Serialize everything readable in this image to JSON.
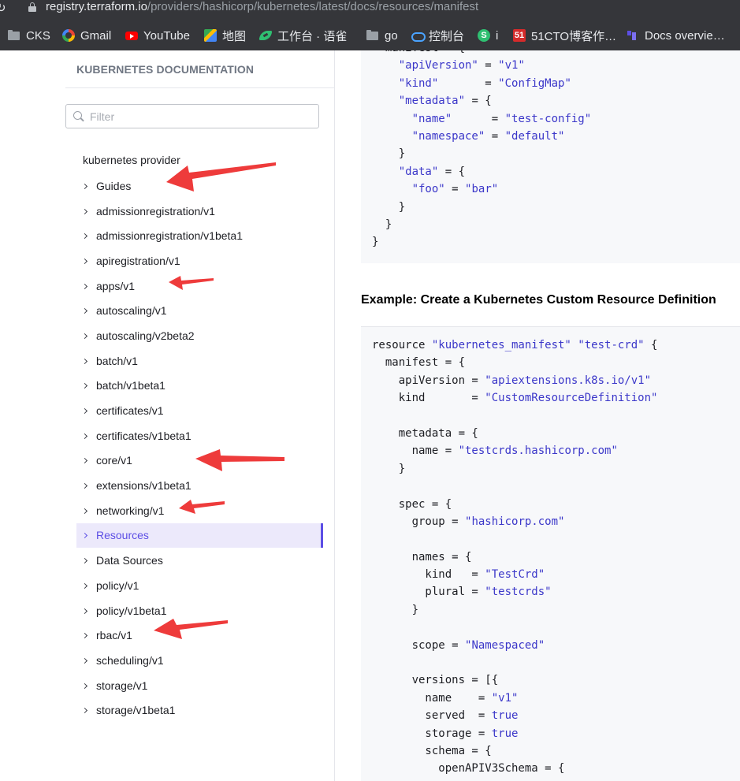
{
  "browser": {
    "reload_glyph": "↻",
    "url_host": "registry.terraform.io",
    "url_path": "/providers/hashicorp/kubernetes/latest/docs/resources/manifest",
    "bookmarks": [
      {
        "label": "CKS",
        "icon": "folder-icon"
      },
      {
        "label": "Gmail",
        "icon": "google-icon"
      },
      {
        "label": "YouTube",
        "icon": "youtube-icon"
      },
      {
        "label": "地图",
        "icon": "maps-icon"
      },
      {
        "label": "工作台 · 语雀",
        "icon": "yuque-icon"
      },
      {
        "label": "go",
        "icon": "folder-icon"
      },
      {
        "label": "控制台",
        "icon": "cloud-console-icon"
      },
      {
        "label": "i",
        "icon": "s-logo-icon"
      },
      {
        "label": "51CTO博客作…",
        "icon": "51cto-icon"
      },
      {
        "label": "Docs overvie…",
        "icon": "terraform-icon"
      }
    ]
  },
  "sidebar": {
    "heading": "KUBERNETES DOCUMENTATION",
    "filter_placeholder": "Filter",
    "provider_label": "kubernetes provider",
    "items": [
      {
        "label": "Guides"
      },
      {
        "label": "admissionregistration/v1"
      },
      {
        "label": "admissionregistration/v1beta1"
      },
      {
        "label": "apiregistration/v1"
      },
      {
        "label": "apps/v1"
      },
      {
        "label": "autoscaling/v1"
      },
      {
        "label": "autoscaling/v2beta2"
      },
      {
        "label": "batch/v1"
      },
      {
        "label": "batch/v1beta1"
      },
      {
        "label": "certificates/v1"
      },
      {
        "label": "certificates/v1beta1"
      },
      {
        "label": "core/v1"
      },
      {
        "label": "extensions/v1beta1"
      },
      {
        "label": "networking/v1"
      },
      {
        "label": "Resources"
      },
      {
        "label": "Data Sources"
      },
      {
        "label": "policy/v1"
      },
      {
        "label": "policy/v1beta1"
      },
      {
        "label": "rbac/v1"
      },
      {
        "label": "scheduling/v1"
      },
      {
        "label": "storage/v1"
      },
      {
        "label": "storage/v1beta1"
      }
    ],
    "active_item": "Resources"
  },
  "content": {
    "first_code_lines": [
      "  manifest = {",
      "    \"apiVersion\" = \"v1\"",
      "    \"kind\"       = \"ConfigMap\"",
      "    \"metadata\" = {",
      "      \"name\"      = \"test-config\"",
      "      \"namespace\" = \"default\"",
      "    }",
      "    \"data\" = {",
      "      \"foo\" = \"bar\"",
      "    }",
      "  }",
      "}"
    ],
    "example_heading": "Example: Create a Kubernetes Custom Resource Definition",
    "second_code_lines": [
      "resource \"kubernetes_manifest\" \"test-crd\" {",
      "  manifest = {",
      "    apiVersion = \"apiextensions.k8s.io/v1\"",
      "    kind       = \"CustomResourceDefinition\"",
      "",
      "    metadata = {",
      "      name = \"testcrds.hashicorp.com\"",
      "    }",
      "",
      "    spec = {",
      "      group = \"hashicorp.com\"",
      "",
      "      names = {",
      "        kind   = \"TestCrd\"",
      "        plural = \"testcrds\"",
      "      }",
      "",
      "      scope = \"Namespaced\"",
      "",
      "      versions = [{",
      "        name    = \"v1\"",
      "        served  = true",
      "        storage = true",
      "        schema = {",
      "          openAPIV3Schema = {"
    ]
  },
  "colors": {
    "accent": "#5c4ee5",
    "active_bg": "#ece9fb",
    "code_string": "#3b37c9",
    "annotation_arrow": "#ee3b3b"
  }
}
